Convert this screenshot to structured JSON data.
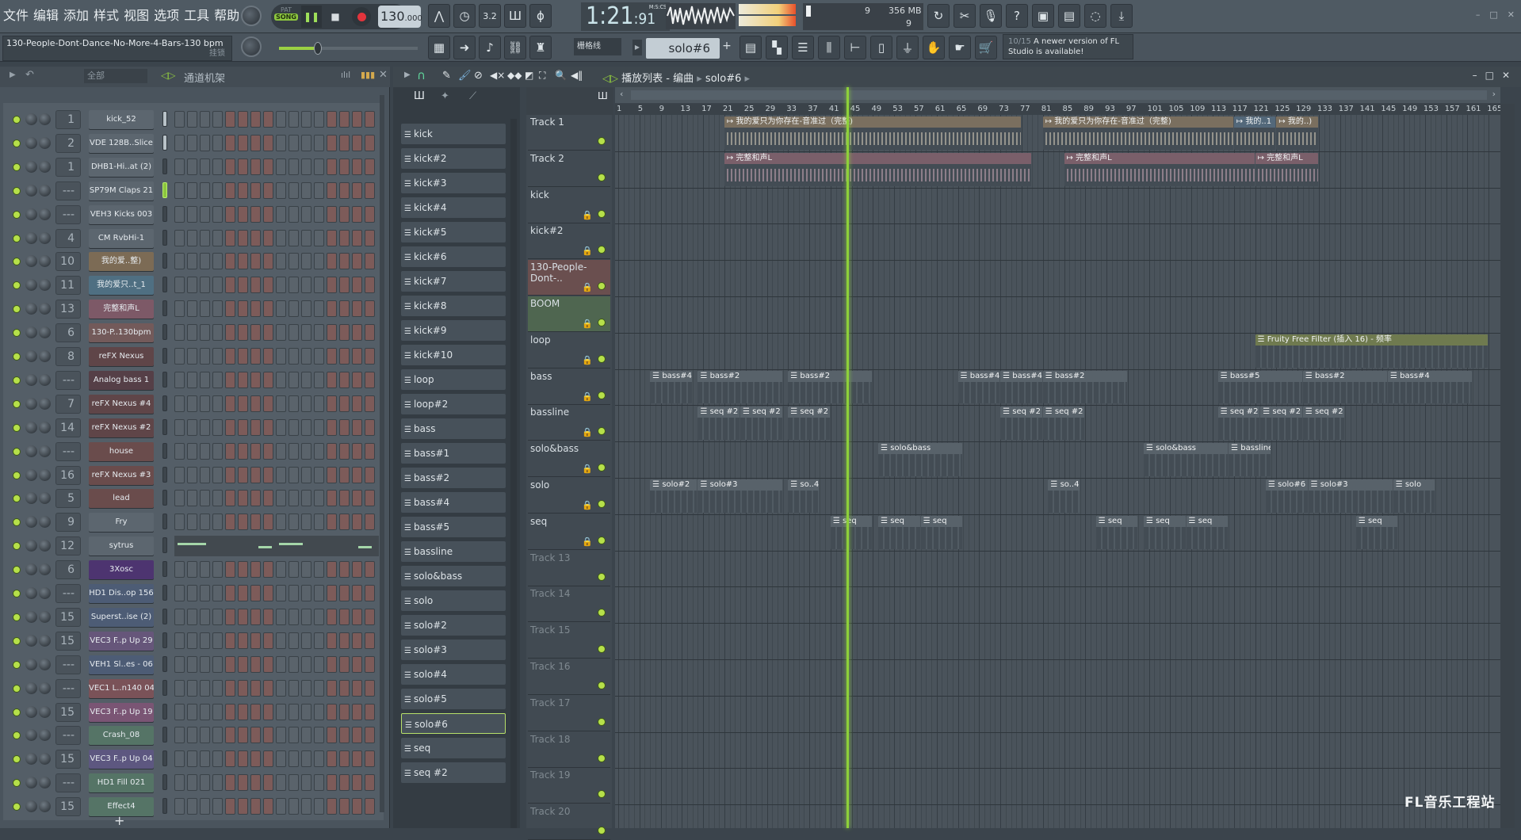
{
  "menu": [
    "文件",
    "编辑",
    "添加",
    "样式",
    "视图",
    "选项",
    "工具",
    "帮助"
  ],
  "project": {
    "name": "130-People-Dont-Dance-No-More-4-Bars-130 bpm",
    "lock_label": "挂锁"
  },
  "transport": {
    "mode_pat": "PAT",
    "mode_song": "SONG",
    "tempo": "130",
    "tempo_dec": ".000",
    "time_main": "1:21",
    "time_cs": ":91",
    "time_format": "M:S:CS"
  },
  "cpu": {
    "value": "9",
    "memory": "356 MB",
    "polyphony": "9"
  },
  "snap": "栅格线",
  "pattern_selector": "solo#6",
  "hint": {
    "counter": "10/15",
    "text": "A newer version of FL Studio is available!"
  },
  "rack": {
    "filter": "全部",
    "title": "通道机架",
    "add": "+",
    "channels": [
      {
        "num": "1",
        "name": "kick_52",
        "color": "#5c666f"
      },
      {
        "num": "2",
        "name": "VDE 128B..Slice",
        "color": "#5c666f"
      },
      {
        "num": "1",
        "name": "DHB1-Hi..at (2)",
        "color": "#5c666f"
      },
      {
        "num": "---",
        "name": "SP79M Claps 21",
        "color": "#5c666f",
        "selected": true
      },
      {
        "num": "---",
        "name": "VEH3 Kicks 003",
        "color": "#5c666f"
      },
      {
        "num": "4",
        "name": "CM RvbHi-1",
        "color": "#5c666f"
      },
      {
        "num": "10",
        "name": "我的爱..整)",
        "color": "#7c6b55"
      },
      {
        "num": "11",
        "name": "我的爱只..t_1",
        "color": "#4f6f82"
      },
      {
        "num": "13",
        "name": "完整和声L",
        "color": "#7d5967"
      },
      {
        "num": "6",
        "name": "130-P..130bpm",
        "color": "#735a5a"
      },
      {
        "num": "8",
        "name": "reFX Nexus",
        "color": "#5f4548"
      },
      {
        "num": "---",
        "name": "Analog bass 1",
        "color": "#553f47"
      },
      {
        "num": "7",
        "name": "reFX Nexus #4",
        "color": "#5f4548"
      },
      {
        "num": "14",
        "name": "reFX Nexus #2",
        "color": "#5f4548"
      },
      {
        "num": "---",
        "name": "house",
        "color": "#6a4c4c"
      },
      {
        "num": "16",
        "name": "reFX Nexus #3",
        "color": "#6a4c4c"
      },
      {
        "num": "5",
        "name": "lead",
        "color": "#6a4c4c"
      },
      {
        "num": "9",
        "name": "Fry",
        "color": "#5c666f"
      },
      {
        "num": "12",
        "name": "sytrus",
        "color": "#5c666f",
        "piano": true
      },
      {
        "num": "6",
        "name": "3Xosc",
        "color": "#4d3470"
      },
      {
        "num": "---",
        "name": "HD1 Dis..op 156",
        "color": "#4d5c75"
      },
      {
        "num": "15",
        "name": "Superst..ise (2)",
        "color": "#4d5c75"
      },
      {
        "num": "15",
        "name": "VEC3 F..p Up 29",
        "color": "#66567a"
      },
      {
        "num": "---",
        "name": "VEH1 Sl..es - 06",
        "color": "#4d5c75"
      },
      {
        "num": "---",
        "name": "VEC1 L..n140 04",
        "color": "#7a5258"
      },
      {
        "num": "15",
        "name": "VEC3 F..p Up 19",
        "color": "#7a5574"
      },
      {
        "num": "---",
        "name": "Crash_08",
        "color": "#557466"
      },
      {
        "num": "15",
        "name": "VEC3 F..p Up 04",
        "color": "#5d5780"
      },
      {
        "num": "---",
        "name": "HD1 Fill 021",
        "color": "#557466"
      },
      {
        "num": "15",
        "name": "Effect4",
        "color": "#557466"
      }
    ]
  },
  "patterns": [
    "kick",
    "kick#2",
    "kick#3",
    "kick#4",
    "kick#5",
    "kick#6",
    "kick#7",
    "kick#8",
    "kick#9",
    "kick#10",
    "loop",
    "loop#2",
    "bass",
    "bass#1",
    "bass#2",
    "bass#4",
    "bass#5",
    "bassline",
    "solo&bass",
    "solo",
    "solo#2",
    "solo#3",
    "solo#4",
    "solo#5",
    "solo#6",
    "seq",
    "seq #2"
  ],
  "active_pattern": "solo#6",
  "playlist": {
    "title": "播放列表 - 编曲",
    "current": "solo#6",
    "tracks": [
      {
        "name": "Track 1"
      },
      {
        "name": "Track 2"
      },
      {
        "name": "kick",
        "lock": true
      },
      {
        "name": "kick#2",
        "lock": true
      },
      {
        "name": "130-People-Dont-..",
        "lock": true,
        "color": "#6a4f4f"
      },
      {
        "name": "BOOM",
        "lock": true,
        "color": "#4f6650"
      },
      {
        "name": "loop",
        "lock": true
      },
      {
        "name": "bass",
        "lock": true
      },
      {
        "name": "bassline",
        "lock": true
      },
      {
        "name": "solo&bass",
        "lock": true
      },
      {
        "name": "solo",
        "lock": true
      },
      {
        "name": "seq",
        "lock": true
      },
      {
        "name": "Track 13",
        "dim": true
      },
      {
        "name": "Track 14",
        "dim": true
      },
      {
        "name": "Track 15",
        "dim": true
      },
      {
        "name": "Track 16",
        "dim": true
      },
      {
        "name": "Track 17",
        "dim": true
      },
      {
        "name": "Track 18",
        "dim": true
      },
      {
        "name": "Track 19",
        "dim": true
      },
      {
        "name": "Track 20",
        "dim": true
      }
    ],
    "bars": [
      "1",
      "5",
      "9",
      "13",
      "17",
      "21",
      "25",
      "29",
      "33",
      "37",
      "41",
      "45",
      "49",
      "53",
      "57",
      "61",
      "65",
      "69",
      "73",
      "77",
      "81",
      "85",
      "89",
      "93",
      "97",
      "101",
      "105",
      "109",
      "113",
      "117",
      "121",
      "125",
      "129",
      "133",
      "137",
      "141",
      "145",
      "149",
      "153",
      "157",
      "161",
      "165"
    ],
    "playhead_bar": 44,
    "clips": [
      {
        "track": 0,
        "start": 21,
        "end": 77,
        "label": "我的爱只为你存在-音准过（完整)",
        "color": "#7a6f5f"
      },
      {
        "track": 0,
        "start": 81,
        "end": 117,
        "label": "我的爱只为你存在-音准过（完整)",
        "color": "#7a6f5f"
      },
      {
        "track": 0,
        "start": 117,
        "end": 125,
        "label": "我的..1",
        "color": "#53687a"
      },
      {
        "track": 0,
        "start": 125,
        "end": 133,
        "label": "我的..)",
        "color": "#7a6f5f"
      },
      {
        "track": 1,
        "start": 21,
        "end": 79,
        "label": "完整和声L",
        "color": "#7a5f6a"
      },
      {
        "track": 1,
        "start": 85,
        "end": 121,
        "label": "完整和声L",
        "color": "#7a5f6a"
      },
      {
        "track": 1,
        "start": 121,
        "end": 133,
        "label": "完整和声L",
        "color": "#7a5f6a"
      },
      {
        "track": 6,
        "start": 121,
        "end": 165,
        "label": "Fruity Free Filter (插入 16) - 频率",
        "color": "#6f7a4f"
      },
      {
        "track": 7,
        "start": 7,
        "end": 15,
        "label": "bass#4",
        "color": "#58626a"
      },
      {
        "track": 7,
        "start": 16,
        "end": 32,
        "label": "bass#2",
        "color": "#58626a"
      },
      {
        "track": 7,
        "start": 33,
        "end": 49,
        "label": "bass#2",
        "color": "#58626a"
      },
      {
        "track": 7,
        "start": 65,
        "end": 73,
        "label": "bass#4",
        "color": "#58626a"
      },
      {
        "track": 7,
        "start": 73,
        "end": 81,
        "label": "bass#4",
        "color": "#58626a"
      },
      {
        "track": 7,
        "start": 81,
        "end": 97,
        "label": "bass#2",
        "color": "#58626a"
      },
      {
        "track": 7,
        "start": 114,
        "end": 130,
        "label": "bass#5",
        "color": "#58626a"
      },
      {
        "track": 7,
        "start": 130,
        "end": 146,
        "label": "bass#2",
        "color": "#58626a"
      },
      {
        "track": 7,
        "start": 146,
        "end": 162,
        "label": "bass#4",
        "color": "#58626a"
      },
      {
        "track": 8,
        "start": 16,
        "end": 24,
        "label": "seq #2",
        "color": "#58626a"
      },
      {
        "track": 8,
        "start": 24,
        "end": 32,
        "label": "seq #2",
        "color": "#58626a"
      },
      {
        "track": 8,
        "start": 33,
        "end": 41,
        "label": "seq #2",
        "color": "#58626a"
      },
      {
        "track": 8,
        "start": 73,
        "end": 81,
        "label": "seq #2",
        "color": "#58626a"
      },
      {
        "track": 8,
        "start": 81,
        "end": 89,
        "label": "seq #2",
        "color": "#58626a"
      },
      {
        "track": 8,
        "start": 114,
        "end": 122,
        "label": "seq #2",
        "color": "#58626a"
      },
      {
        "track": 8,
        "start": 122,
        "end": 130,
        "label": "seq #2",
        "color": "#58626a"
      },
      {
        "track": 8,
        "start": 130,
        "end": 138,
        "label": "seq #2",
        "color": "#58626a"
      },
      {
        "track": 9,
        "start": 50,
        "end": 66,
        "label": "solo&bass",
        "color": "#58626a"
      },
      {
        "track": 9,
        "start": 100,
        "end": 116,
        "label": "solo&bass",
        "color": "#58626a"
      },
      {
        "track": 9,
        "start": 116,
        "end": 124,
        "label": "bassline",
        "color": "#58626a"
      },
      {
        "track": 10,
        "start": 7,
        "end": 16,
        "label": "solo#2",
        "color": "#58626a"
      },
      {
        "track": 10,
        "start": 16,
        "end": 32,
        "label": "solo#3",
        "color": "#58626a"
      },
      {
        "track": 10,
        "start": 33,
        "end": 39,
        "label": "so..4",
        "color": "#58626a"
      },
      {
        "track": 10,
        "start": 82,
        "end": 88,
        "label": "so..4",
        "color": "#58626a"
      },
      {
        "track": 10,
        "start": 123,
        "end": 131,
        "label": "solo#6",
        "color": "#58626a"
      },
      {
        "track": 10,
        "start": 131,
        "end": 147,
        "label": "solo#3",
        "color": "#58626a"
      },
      {
        "track": 10,
        "start": 147,
        "end": 155,
        "label": "solo",
        "color": "#58626a"
      },
      {
        "track": 11,
        "start": 41,
        "end": 49,
        "label": "seq",
        "color": "#58626a"
      },
      {
        "track": 11,
        "start": 50,
        "end": 58,
        "label": "seq",
        "color": "#58626a"
      },
      {
        "track": 11,
        "start": 58,
        "end": 66,
        "label": "seq",
        "color": "#58626a"
      },
      {
        "track": 11,
        "start": 91,
        "end": 99,
        "label": "seq",
        "color": "#58626a"
      },
      {
        "track": 11,
        "start": 100,
        "end": 108,
        "label": "seq",
        "color": "#58626a"
      },
      {
        "track": 11,
        "start": 108,
        "end": 116,
        "label": "seq",
        "color": "#58626a"
      },
      {
        "track": 11,
        "start": 140,
        "end": 148,
        "label": "seq",
        "color": "#58626a"
      }
    ]
  },
  "watermark": "FL音乐工程站"
}
